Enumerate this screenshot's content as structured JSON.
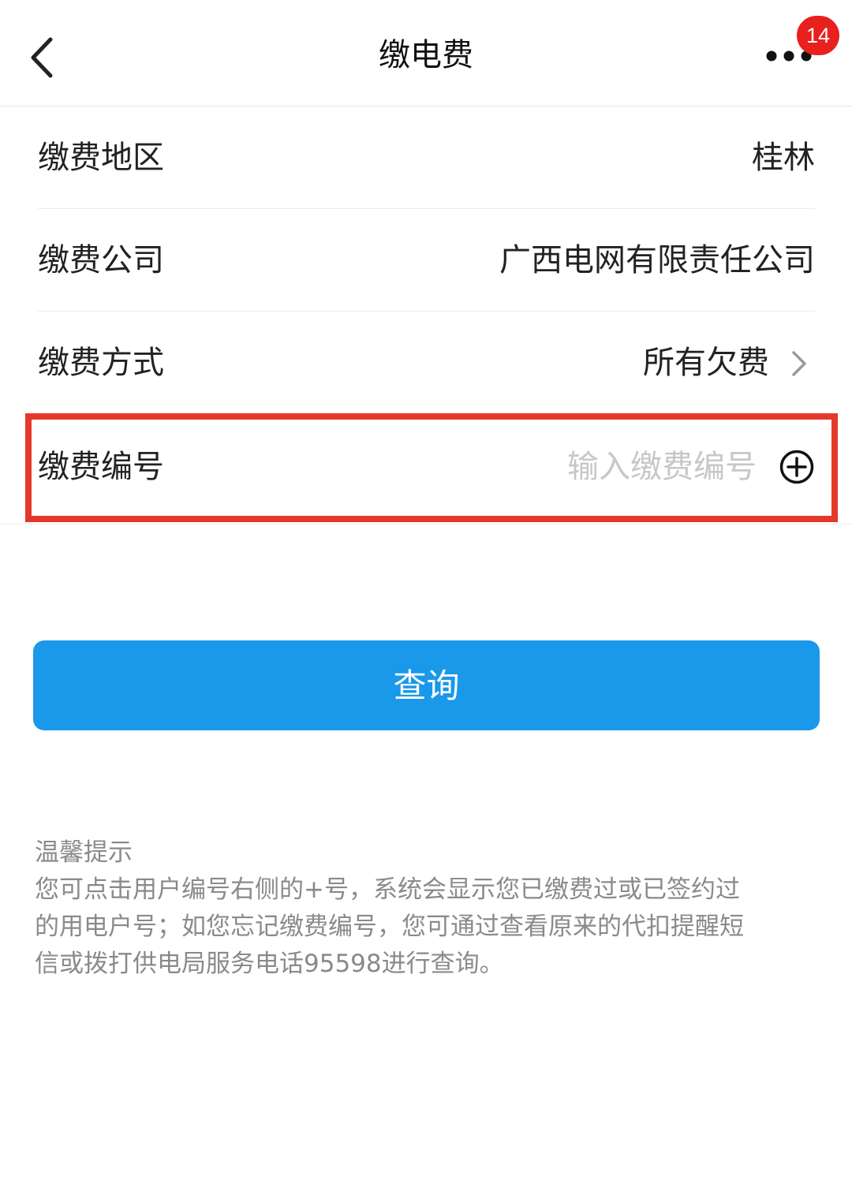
{
  "header": {
    "title": "缴电费",
    "badge_count": "14"
  },
  "form": {
    "rows": [
      {
        "label": "缴费地区",
        "value": "桂林"
      },
      {
        "label": "缴费公司",
        "value": "广西电网有限责任公司"
      },
      {
        "label": "缴费方式",
        "value": "所有欠费"
      },
      {
        "label": "缴费编号",
        "placeholder": "输入缴费编号"
      }
    ]
  },
  "query_button": {
    "label": "查询"
  },
  "tips": {
    "title": "温馨提示",
    "lines": [
      "您可点击用户编号右侧的+号，系统会显示您已缴费过或已签约过",
      "的用电户号；如您忘记缴费编号，您可通过查看原来的代扣提醒短",
      "信或拨打供电局服务电话95598进行查询。"
    ]
  },
  "colors": {
    "primary": "#1a98ea",
    "badge": "#e8201e",
    "highlight": "#e5382b",
    "placeholder": "#c7c7c7"
  }
}
